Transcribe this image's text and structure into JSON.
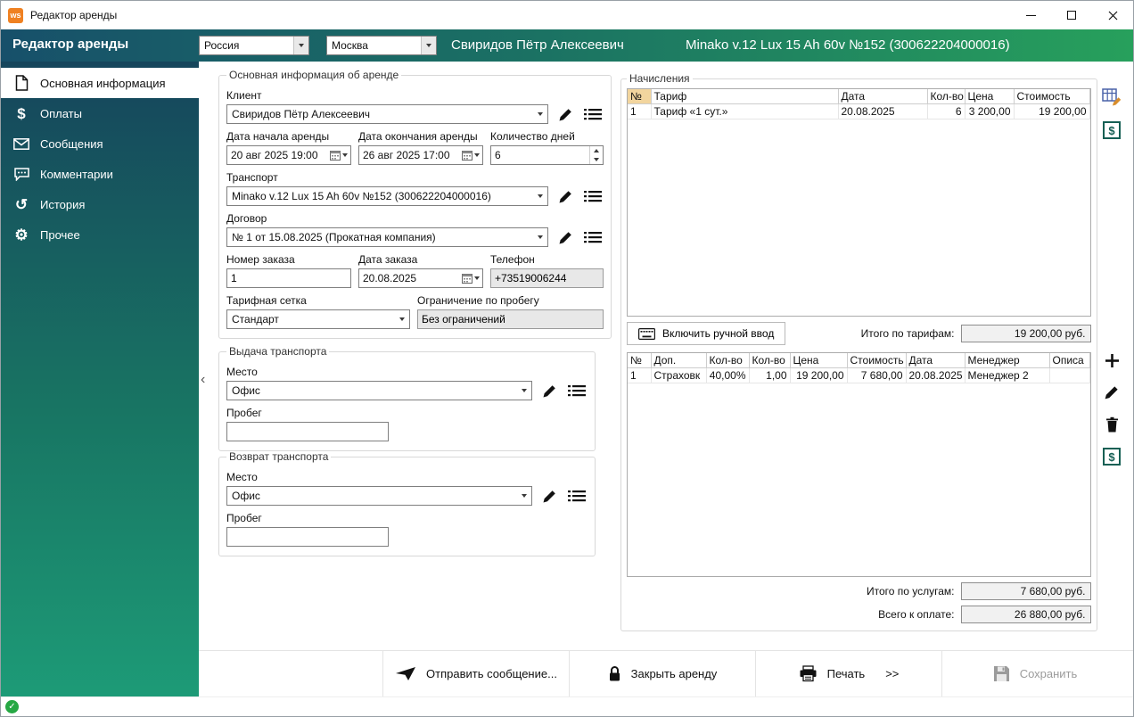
{
  "icons": {
    "dollar": "$",
    "gear": "⚙",
    "history": "↺",
    "check": "✓",
    "collapse": "‹"
  },
  "window": {
    "title": "Редактор аренды",
    "badge": "ws"
  },
  "header": {
    "title": "Редактор аренды",
    "country": "Россия",
    "city": "Москва",
    "client": "Свиридов Пётр Алексеевич",
    "vehicle": "Minako v.12 Lux 15 Ah 60v №152 (300622204000016)"
  },
  "sidebar": {
    "items": [
      {
        "label": "Основная информация"
      },
      {
        "label": "Оплаты"
      },
      {
        "label": "Сообщения"
      },
      {
        "label": "Комментарии"
      },
      {
        "label": "История"
      },
      {
        "label": "Прочее"
      }
    ]
  },
  "form": {
    "group_title": "Основная информация об аренде",
    "client_label": "Клиент",
    "client_value": "Свиридов Пётр Алексеевич",
    "date_start_label": "Дата начала аренды",
    "date_start_value": "20 авг 2025 19:00",
    "date_end_label": "Дата окончания аренды",
    "date_end_value": "26 авг 2025 17:00",
    "days_label": "Количество дней",
    "days_value": "6",
    "transport_label": "Транспорт",
    "transport_value": "Minako v.12 Lux 15 Ah 60v №152 (300622204000016)",
    "contract_label": "Договор",
    "contract_value": "№ 1 от 15.08.2025 (Прокатная компания)",
    "order_number_label": "Номер заказа",
    "order_number_value": "1",
    "order_date_label": "Дата заказа",
    "order_date_value": "20.08.2025",
    "phone_label": "Телефон",
    "phone_value": "+73519006244",
    "tariff_label": "Тарифная сетка",
    "tariff_value": "Стандарт",
    "limit_label": "Ограничение по пробегу",
    "limit_value": "Без ограничений"
  },
  "pickup": {
    "group_title": "Выдача транспорта",
    "place_label": "Место",
    "place_value": "Офис",
    "mileage_label": "Пробег",
    "mileage_value": ""
  },
  "return_transport": {
    "group_title": "Возврат транспорта",
    "place_label": "Место",
    "place_value": "Офис",
    "mileage_label": "Пробег",
    "mileage_value": ""
  },
  "charges": {
    "group_title": "Начисления",
    "tariff_table": {
      "headers": [
        "№",
        "Тариф",
        "Дата",
        "Кол-во",
        "Цена",
        "Стоимость"
      ],
      "rows": [
        [
          "1",
          "Тариф «1 сут.»",
          "20.08.2025",
          "6",
          "3 200,00",
          "19 200,00"
        ]
      ]
    },
    "manual_button": "Включить ручной ввод",
    "tariff_total_label": "Итого по тарифам:",
    "tariff_total_value": "19 200,00 руб.",
    "services_table": {
      "headers": [
        "№",
        "Доп.",
        "Кол-во",
        "Кол-во",
        "Цена",
        "Стоимость",
        "Дата",
        "Менеджер",
        "Описа"
      ],
      "rows": [
        [
          "1",
          "Страховк",
          "40,00%",
          "1,00",
          "19 200,00",
          "7 680,00",
          "20.08.2025",
          "Менеджер 2",
          ""
        ]
      ]
    },
    "services_total_label": "Итого по услугам:",
    "services_total_value": "7 680,00 руб.",
    "grand_total_label": "Всего к оплате:",
    "grand_total_value": "26 880,00 руб."
  },
  "toolbar": {
    "send": "Отправить сообщение...",
    "close": "Закрыть аренду",
    "print": "Печать",
    "print_chevrons": ">>",
    "save": "Сохранить"
  }
}
